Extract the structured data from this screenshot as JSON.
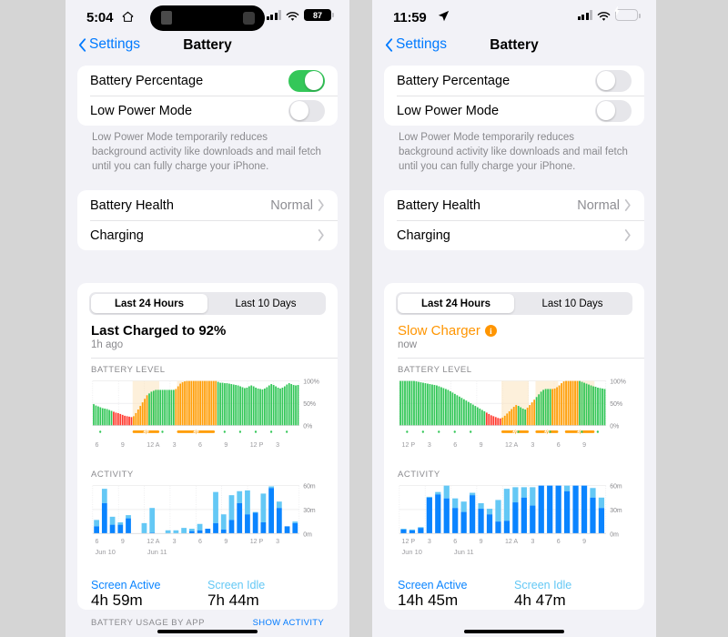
{
  "background_color": "#d5d5d5",
  "phones": [
    {
      "id": "left",
      "status_bar": {
        "time": "5:04",
        "time_icon": "home-icon",
        "time_icon_glyph": "⌂",
        "has_dynamic_island": true,
        "signal_bars": 3,
        "wifi_icon": "wifi-icon",
        "battery_display": "percentage-badge",
        "battery_percent": "87",
        "battery_charging": false
      },
      "nav": {
        "back_label": "Settings",
        "title": "Battery"
      },
      "settings_group_1": {
        "rows": [
          {
            "label": "Battery Percentage",
            "control": "toggle",
            "state": "on"
          },
          {
            "label": "Low Power Mode",
            "control": "toggle",
            "state": "off"
          }
        ],
        "footnote": "Low Power Mode temporarily reduces background activity like downloads and mail fetch until you can fully charge your iPhone."
      },
      "settings_group_2": {
        "rows": [
          {
            "label": "Battery Health",
            "value": "Normal",
            "control": "chevron"
          },
          {
            "label": "Charging",
            "value": "",
            "control": "chevron"
          }
        ]
      },
      "segmented": {
        "options": [
          "Last 24 Hours",
          "Last 10 Days"
        ],
        "selected": 0
      },
      "charge_status": {
        "title": "Last Charged to 92%",
        "subtitle": "1h ago",
        "warning": false,
        "info_badge": false
      },
      "battery_chart": {
        "label": "BATTERY LEVEL",
        "y_ticks": [
          "100%",
          "50%",
          "0%"
        ],
        "x_ticks": [
          "6",
          "9",
          "12 A",
          "3",
          "6",
          "9",
          "12 P",
          "3"
        ]
      },
      "activity_chart": {
        "label": "ACTIVITY",
        "y_ticks": [
          "60m",
          "30m",
          "0m"
        ],
        "x_ticks": [
          "6",
          "9",
          "12 A",
          "3",
          "6",
          "9",
          "12 P",
          "3"
        ],
        "day_labels": [
          "Jun 10",
          "Jun 11"
        ]
      },
      "stats": [
        {
          "label": "Screen Active",
          "value": "4h 59m",
          "kind": "active"
        },
        {
          "label": "Screen Idle",
          "value": "7h 44m",
          "kind": "idle"
        }
      ],
      "bottom": {
        "left": "BATTERY USAGE BY APP",
        "right": "SHOW ACTIVITY"
      }
    },
    {
      "id": "right",
      "status_bar": {
        "time": "11:59",
        "time_icon": "location-arrow-icon",
        "time_icon_glyph": "➤",
        "has_dynamic_island": false,
        "signal_bars": 3,
        "wifi_icon": "wifi-icon",
        "battery_display": "charging-battery",
        "battery_percent": "",
        "battery_charging": true
      },
      "nav": {
        "back_label": "Settings",
        "title": "Battery"
      },
      "settings_group_1": {
        "rows": [
          {
            "label": "Battery Percentage",
            "control": "toggle",
            "state": "off"
          },
          {
            "label": "Low Power Mode",
            "control": "toggle",
            "state": "off"
          }
        ],
        "footnote": "Low Power Mode temporarily reduces background activity like downloads and mail fetch until you can fully charge your iPhone."
      },
      "settings_group_2": {
        "rows": [
          {
            "label": "Battery Health",
            "value": "Normal",
            "control": "chevron"
          },
          {
            "label": "Charging",
            "value": "",
            "control": "chevron"
          }
        ]
      },
      "segmented": {
        "options": [
          "Last 24 Hours",
          "Last 10 Days"
        ],
        "selected": 0
      },
      "charge_status": {
        "title": "Slow Charger",
        "subtitle": "now",
        "warning": true,
        "info_badge": true,
        "info_glyph": "i"
      },
      "battery_chart": {
        "label": "BATTERY LEVEL",
        "y_ticks": [
          "100%",
          "50%",
          "0%"
        ],
        "x_ticks": [
          "12 P",
          "3",
          "6",
          "9",
          "12 A",
          "3",
          "6",
          "9"
        ]
      },
      "activity_chart": {
        "label": "ACTIVITY",
        "y_ticks": [
          "60m",
          "30m",
          "0m"
        ],
        "x_ticks": [
          "12 P",
          "3",
          "6",
          "9",
          "12 A",
          "3",
          "6",
          "9"
        ],
        "day_labels": [
          "Jun 10",
          "Jun 11"
        ]
      },
      "stats": [
        {
          "label": "Screen Active",
          "value": "14h 45m",
          "kind": "active"
        },
        {
          "label": "Screen Idle",
          "value": "4h 47m",
          "kind": "idle"
        }
      ],
      "bottom": {
        "left": "",
        "right": ""
      }
    }
  ],
  "colors": {
    "green": "#34c759",
    "green_light": "#b8ecc4",
    "orange": "#ff9f0a",
    "orange_tint": "#fbe3bd",
    "red": "#ff3b30",
    "blue": "#0a84ff",
    "blue_light": "#64c8f5",
    "ios_blue": "#007aff",
    "gray_text": "#8a8a8e",
    "card": "#ffffff",
    "page_bg": "#f2f2f7"
  },
  "chart_data": [
    {
      "id": "left-battery-level",
      "type": "bar",
      "title": "BATTERY LEVEL",
      "ylabel": "",
      "xlabel": "",
      "ylim": [
        0,
        100
      ],
      "y_ticks": [
        0,
        50,
        100
      ],
      "y_tick_labels": [
        "0%",
        "50%",
        "100%"
      ],
      "x_tick_labels": [
        "6",
        "9",
        "12 A",
        "3",
        "6",
        "9",
        "12 P",
        "3"
      ],
      "grid": true,
      "legend": "none",
      "bar_colors_meaning": {
        "green": "normal",
        "orange": "charging",
        "red": "low battery"
      },
      "shaded_regions": [
        {
          "from_index": 18,
          "to_index": 30,
          "color": "#fbe3bd",
          "meaning": "charging-session"
        },
        {
          "from_index": 38,
          "to_index": 55,
          "color": "#fbe3bd",
          "meaning": "charging-session"
        }
      ],
      "values": [
        48,
        45,
        43,
        41,
        39,
        38,
        37,
        35,
        33,
        31,
        29,
        28,
        26,
        24,
        22,
        21,
        20,
        19,
        21,
        28,
        36,
        44,
        52,
        60,
        68,
        72,
        76,
        78,
        80,
        80,
        80,
        80,
        80,
        80,
        80,
        80,
        80,
        82,
        88,
        94,
        97,
        99,
        100,
        100,
        100,
        100,
        100,
        100,
        100,
        100,
        100,
        100,
        100,
        100,
        100,
        100,
        98,
        96,
        96,
        95,
        95,
        94,
        93,
        92,
        91,
        90,
        88,
        86,
        84,
        85,
        88,
        90,
        88,
        85,
        83,
        82,
        81,
        83,
        86,
        90,
        93,
        91,
        88,
        85,
        83,
        85,
        88,
        92,
        95,
        93,
        91,
        90,
        91
      ],
      "bar_states": [
        "green",
        "green",
        "green",
        "green",
        "green",
        "green",
        "green",
        "green",
        "green",
        "red",
        "red",
        "red",
        "red",
        "red",
        "red",
        "red",
        "red",
        "red",
        "orange",
        "orange",
        "orange",
        "orange",
        "orange",
        "orange",
        "orange",
        "green",
        "green",
        "green",
        "green",
        "green",
        "green",
        "green",
        "green",
        "green",
        "green",
        "green",
        "green",
        "orange",
        "orange",
        "orange",
        "orange",
        "orange",
        "orange",
        "orange",
        "orange",
        "orange",
        "orange",
        "orange",
        "orange",
        "orange",
        "orange",
        "orange",
        "orange",
        "orange",
        "orange",
        "orange",
        "green",
        "green",
        "green",
        "green",
        "green",
        "green",
        "green",
        "green",
        "green",
        "green",
        "green",
        "green",
        "green",
        "green",
        "green",
        "green",
        "green",
        "green",
        "green",
        "green",
        "green",
        "green",
        "green",
        "green",
        "green",
        "green",
        "green",
        "green",
        "green",
        "green",
        "green",
        "green",
        "green",
        "green",
        "green",
        "green"
      ]
    },
    {
      "id": "left-activity",
      "type": "bar",
      "stacked": true,
      "title": "ACTIVITY",
      "ylim": [
        0,
        60
      ],
      "y_ticks": [
        0,
        30,
        60
      ],
      "y_tick_labels": [
        "0m",
        "30m",
        "60m"
      ],
      "x_tick_labels": [
        "6",
        "9",
        "12 A",
        "3",
        "6",
        "9",
        "12 P",
        "3"
      ],
      "day_labels": [
        "Jun 10",
        "Jun 11"
      ],
      "series": [
        {
          "name": "Screen Active",
          "color": "#0a84ff",
          "values": [
            9,
            38,
            11,
            11,
            19,
            0,
            0,
            1,
            0,
            0,
            0,
            0,
            3,
            4,
            6,
            13,
            5,
            17,
            38,
            24,
            26,
            14,
            57,
            32,
            9,
            13
          ]
        },
        {
          "name": "Screen Idle",
          "color": "#64c8f5",
          "values": [
            8,
            18,
            10,
            3,
            4,
            0,
            13,
            31,
            0,
            4,
            4,
            7,
            3,
            8,
            0,
            39,
            19,
            31,
            15,
            30,
            1,
            36,
            2,
            8,
            0,
            2
          ]
        }
      ]
    },
    {
      "id": "right-battery-level",
      "type": "bar",
      "title": "BATTERY LEVEL",
      "ylim": [
        0,
        100
      ],
      "y_ticks": [
        0,
        50,
        100
      ],
      "y_tick_labels": [
        "0%",
        "50%",
        "100%"
      ],
      "x_tick_labels": [
        "12 P",
        "3",
        "6",
        "9",
        "12 A",
        "3",
        "6",
        "9"
      ],
      "grid": true,
      "shaded_regions": [
        {
          "from_index": 45,
          "to_index": 57,
          "color": "#fbe3bd",
          "meaning": "charging-session"
        },
        {
          "from_index": 60,
          "to_index": 70,
          "color": "#fbe3bd",
          "meaning": "charging-session"
        },
        {
          "from_index": 73,
          "to_index": 86,
          "color": "#fbe3bd",
          "meaning": "charging-session"
        }
      ],
      "values": [
        100,
        100,
        100,
        100,
        100,
        100,
        100,
        99,
        98,
        97,
        96,
        95,
        94,
        93,
        92,
        91,
        90,
        88,
        86,
        84,
        82,
        80,
        77,
        74,
        71,
        68,
        65,
        62,
        59,
        56,
        53,
        50,
        47,
        44,
        41,
        38,
        35,
        32,
        29,
        26,
        23,
        21,
        19,
        17,
        16,
        18,
        22,
        27,
        32,
        37,
        42,
        46,
        44,
        41,
        38,
        36,
        40,
        46,
        52,
        58,
        64,
        70,
        76,
        80,
        82,
        82,
        82,
        82,
        83,
        86,
        90,
        95,
        99,
        100,
        100,
        100,
        100,
        100,
        100,
        100,
        98,
        96,
        94,
        92,
        90,
        88,
        87,
        85,
        84,
        83,
        82
      ],
      "bar_states": [
        "green",
        "green",
        "green",
        "green",
        "green",
        "green",
        "green",
        "green",
        "green",
        "green",
        "green",
        "green",
        "green",
        "green",
        "green",
        "green",
        "green",
        "green",
        "green",
        "green",
        "green",
        "green",
        "green",
        "green",
        "green",
        "green",
        "green",
        "green",
        "green",
        "green",
        "green",
        "green",
        "green",
        "green",
        "green",
        "green",
        "green",
        "green",
        "red",
        "red",
        "red",
        "red",
        "red",
        "red",
        "red",
        "orange",
        "orange",
        "orange",
        "orange",
        "orange",
        "orange",
        "orange",
        "green",
        "green",
        "green",
        "green",
        "orange",
        "orange",
        "orange",
        "orange",
        "green",
        "green",
        "green",
        "green",
        "green",
        "green",
        "green",
        "orange",
        "orange",
        "orange",
        "orange",
        "orange",
        "orange",
        "orange",
        "orange",
        "orange",
        "orange",
        "orange",
        "orange",
        "green",
        "green",
        "green",
        "green",
        "green",
        "green",
        "green",
        "green",
        "green",
        "green",
        "green"
      ]
    },
    {
      "id": "right-activity",
      "type": "bar",
      "stacked": true,
      "title": "ACTIVITY",
      "ylim": [
        0,
        60
      ],
      "y_ticks": [
        0,
        30,
        60
      ],
      "y_tick_labels": [
        "0m",
        "30m",
        "60m"
      ],
      "x_tick_labels": [
        "12 P",
        "3",
        "6",
        "9",
        "12 A",
        "3",
        "6",
        "9"
      ],
      "day_labels": [
        "Jun 10",
        "Jun 11"
      ],
      "series": [
        {
          "name": "Screen Active",
          "color": "#0a84ff",
          "values": [
            5,
            4,
            7,
            45,
            49,
            44,
            32,
            27,
            48,
            31,
            24,
            15,
            16,
            39,
            45,
            35,
            60,
            60,
            60,
            53,
            60,
            60,
            45,
            32
          ]
        },
        {
          "name": "Screen Idle",
          "color": "#64c8f5",
          "values": [
            1,
            1,
            1,
            1,
            3,
            16,
            12,
            13,
            3,
            7,
            7,
            27,
            40,
            19,
            13,
            23,
            0,
            0,
            0,
            7,
            0,
            0,
            12,
            13
          ]
        }
      ]
    }
  ]
}
